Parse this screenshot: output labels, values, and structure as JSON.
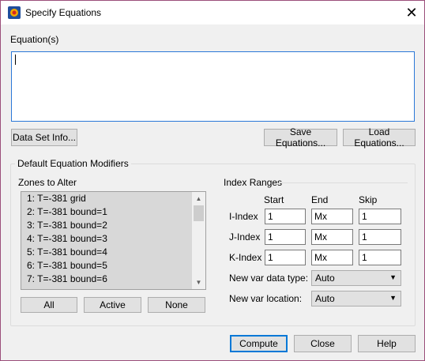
{
  "window": {
    "title": "Specify Equations",
    "close_symbol": "✕"
  },
  "equations": {
    "label": "Equation(s)",
    "value": ""
  },
  "buttons": {
    "data_set_info": "Data Set Info...",
    "save_equations": "Save Equations...",
    "load_equations": "Load Equations...",
    "all": "All",
    "active": "Active",
    "none": "None",
    "compute": "Compute",
    "close": "Close",
    "help": "Help"
  },
  "modifiers": {
    "title": "Default Equation Modifiers",
    "zones_label": "Zones to Alter",
    "zones": [
      "1: T=-381 grid",
      "2: T=-381 bound=1",
      "3: T=-381 bound=2",
      "4: T=-381 bound=3",
      "5: T=-381 bound=4",
      "6: T=-381 bound=5",
      "7: T=-381 bound=6"
    ],
    "index_ranges": {
      "title": "Index Ranges",
      "col_start": "Start",
      "col_end": "End",
      "col_skip": "Skip",
      "i_label": "I-Index",
      "j_label": "J-Index",
      "k_label": "K-Index",
      "i": {
        "start": "1",
        "end": "Mx",
        "skip": "1"
      },
      "j": {
        "start": "1",
        "end": "Mx",
        "skip": "1"
      },
      "k": {
        "start": "1",
        "end": "Mx",
        "skip": "1"
      }
    },
    "data_type_label": "New var data type:",
    "data_type_value": "Auto",
    "location_label": "New var location:",
    "location_value": "Auto"
  }
}
